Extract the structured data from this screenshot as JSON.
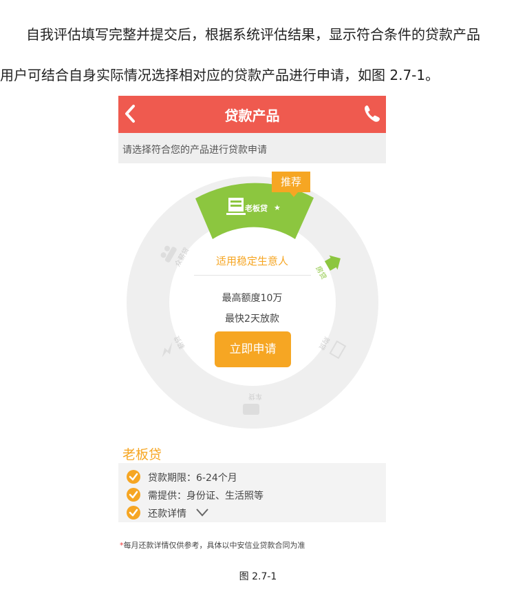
{
  "document": {
    "paragraph_line1": "自我评估填写完整并提交后，根据系统评估结果，显示符合条件的贷款产品",
    "paragraph_line2": "用户可结合自身实际情况选择相对应的贷款产品进行申请，如图 2.7-1。",
    "caption": "图 2.7-1"
  },
  "app": {
    "title": "贷款产品",
    "back_icon": "chevron-left-icon",
    "phone_icon": "phone-icon",
    "subtitle": "请选择符合您的产品进行贷款申请",
    "recommend_tag": "推荐",
    "selected_product": "老板贷",
    "wheel_products": [
      "老板贷",
      "房贷",
      "购贷",
      "车贷",
      "薪贷",
      "众薪贷"
    ],
    "fit_text": "适用稳定生意人",
    "max_limit": "最高额度10万",
    "speed": "最快2天放款",
    "apply_button": "立即申请",
    "product_title": "老板贷",
    "details": {
      "term": "贷款期限：6-24个月",
      "required": "需提供：身份证、生活照等",
      "repay": "还款详情"
    },
    "note_star": "*",
    "note": "每月还款详情仅供参考，具体以中安信业贷款合同为准",
    "colors": {
      "header": "#ef5a4f",
      "accent": "#f6a623",
      "selected_segment": "#8cc63f",
      "ring": "#efefef"
    }
  }
}
